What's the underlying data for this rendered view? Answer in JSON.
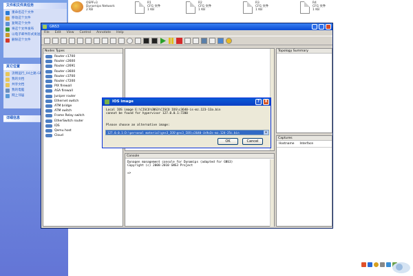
{
  "explorer": {
    "file_tasks_title": "文件和文件夹任务",
    "file_tasks": [
      {
        "label": "重命名这个文件",
        "icon": "rename-icon",
        "color": "#2a7bd6"
      },
      {
        "label": "移动这个文件",
        "icon": "move-icon",
        "color": "#d8a13a"
      },
      {
        "label": "复制这个文件",
        "icon": "copy-icon",
        "color": "#5b8fd7"
      },
      {
        "label": "将这个文件发布",
        "icon": "publish-icon",
        "color": "#3a9a3a"
      },
      {
        "label": "以电子邮件形式发送此文件",
        "icon": "email-icon",
        "color": "#c79a2a"
      },
      {
        "label": "删除这个文件",
        "icon": "delete-icon",
        "color": "#d43a2a"
      }
    ],
    "other_places_title": "其它位置",
    "other_places": [
      {
        "label": "流畅运行_04之路-GNS3",
        "icon": "folder-icon",
        "color": "#e8c65a"
      },
      {
        "label": "我的文档",
        "icon": "folder-icon",
        "color": "#e8c65a"
      },
      {
        "label": "共享文档",
        "icon": "folder-icon",
        "color": "#e8c65a"
      },
      {
        "label": "我的电脑",
        "icon": "computer-icon",
        "color": "#6b8fbf"
      },
      {
        "label": "网上邻居",
        "icon": "network-icon",
        "color": "#5a9ad7"
      }
    ],
    "details_title": "详细信息"
  },
  "desktop_files": [
    {
      "name": "OSPFv3",
      "line2": "Dynamips Network",
      "line3": "2 KB"
    },
    {
      "name": "R1",
      "line2": "CFG 文件",
      "line3": "1 KB"
    },
    {
      "name": "R2",
      "line2": "CFG 文件",
      "line3": "1 KB"
    },
    {
      "name": "R3",
      "line2": "CFG 文件",
      "line3": "1 KB"
    },
    {
      "name": "R4",
      "line2": "CFG 文件",
      "line3": "1 KB"
    }
  ],
  "gns3": {
    "title": "GNS3",
    "menu": [
      "File",
      "Edit",
      "View",
      "Control",
      "Annotate",
      "Help"
    ],
    "node_types_title": "Nodes Types",
    "nodes": [
      "Router c1700",
      "Router c2600",
      "Router c2691",
      "Router c3600",
      "Router c3700",
      "Router c7200",
      "PIX firewall",
      "ASA firewall",
      "Juniper router",
      "Ethernet switch",
      "ATM bridge",
      "ATM switch",
      "Frame Relay switch",
      "EtherSwitch router",
      "IDS",
      "Qemu host",
      "Cloud"
    ],
    "topology_title": "Topology Summary",
    "captures_title": "Captures",
    "captures_cols": [
      "Hostname",
      "Interface"
    ],
    "console_title": "Console",
    "console_lines": [
      "Dynagen management console for Dynamips (adapted for GNS3)",
      "Copyright (c) 2008-2010 GNS3 Project",
      "",
      "=>"
    ]
  },
  "dialog": {
    "title": "IOS image",
    "line1": "Local IOS image E:\\CISCO\\GNS3\\CISCO IOS\\c3640-is-mz.123-13a.bin",
    "line2": "cannot be found for hypervisor 127.0.0.1:7200",
    "line3": "Please choose an alternative image:",
    "select_value": "127.0.0.1:D:\\personal material\\gns3_IOS\\gns3_IOS\\c3640-ik9o3s-mz.124-25c.bin",
    "ok": "OK",
    "cancel": "Cancel",
    "help_btn": "?",
    "close_btn": "X"
  }
}
